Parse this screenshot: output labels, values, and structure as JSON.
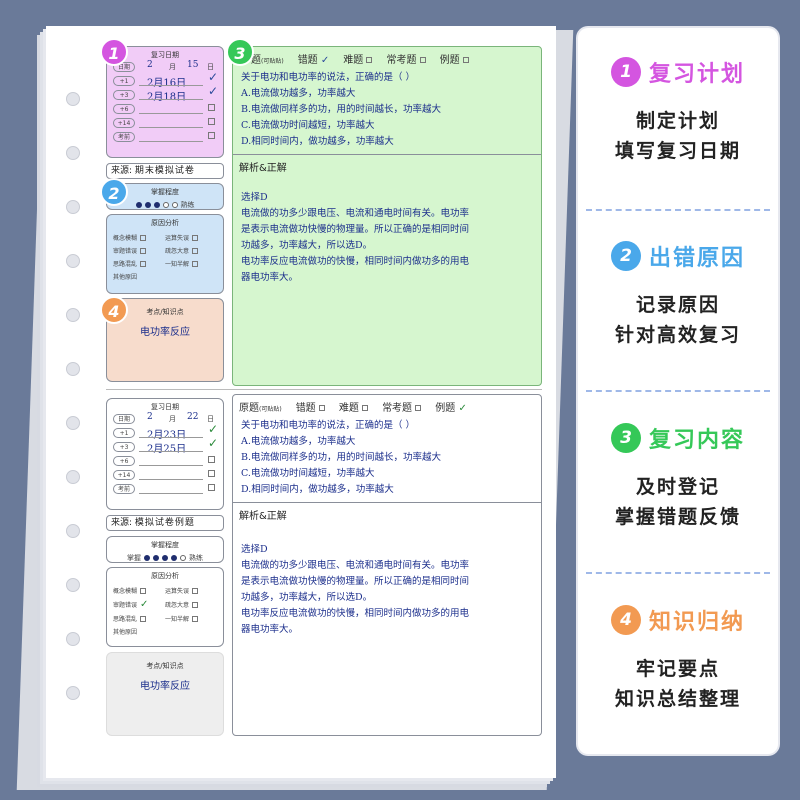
{
  "colors": {
    "purple": "#d455e0",
    "blue": "#4aa8ea",
    "green": "#35c858",
    "orange": "#f29a52",
    "purple_bg": "#f1ccf7",
    "blue_bg": "#cfe4f7",
    "green_bg": "#d6f6cf",
    "orange_bg": "#f7dccc"
  },
  "badges": [
    "1",
    "2",
    "3",
    "4"
  ],
  "card1": {
    "review_date_title": "复习日期",
    "date_label": "日期",
    "date_month": "2",
    "month_unit": "月",
    "date_day": "15",
    "day_unit": "日",
    "rows": [
      {
        "tag": "+1",
        "value": "2月16日",
        "checked": true
      },
      {
        "tag": "+3",
        "value": "2月18日",
        "checked": true
      },
      {
        "tag": "+6",
        "value": "",
        "checked": false
      },
      {
        "tag": "+14",
        "value": "",
        "checked": false
      },
      {
        "tag": "考前",
        "value": "",
        "checked": false
      }
    ],
    "source_label": "来源:",
    "source_value": "期末模拟试卷",
    "mastery_title": "掌握程度",
    "mastery_end": "熟练",
    "reason_title": "原因分析",
    "reasons": [
      "概念模糊",
      "运算失误",
      "审题错误",
      "疏忽大意",
      "思路混乱",
      "一知半解"
    ],
    "other_reason": "其他原因",
    "knowledge_title": "考点/知识点",
    "knowledge_value": "电功率反应",
    "head": {
      "q": "题",
      "q_note": "(可贴贴)",
      "wrong": "错题",
      "hard": "难题",
      "common": "常考题",
      "example": "例题"
    },
    "question": [
      "关于电功和电功率的说法，正确的是（ ）",
      "A.电流做功越多，功率越大",
      "B.电流做同样多的功，用的时间越长，功率越大",
      "C.电流做功时间越短，功率越大",
      "D.相同时间内，做功越多，功率越大"
    ],
    "analysis_title": "解析&正解",
    "analysis": [
      "选择D",
      "电流做的功多少跟电压、电流和通电时间有关。电功率",
      "是表示电流做功快慢的物理量。所以正确的是相同时间",
      "功越多，功率越大，所以选D。",
      "电功率反应电流做功的快慢，相同时间内做功多的用电",
      "器电功率大。"
    ]
  },
  "card2": {
    "review_date_title": "复习日期",
    "date_label": "日期",
    "date_month": "2",
    "month_unit": "月",
    "date_day": "22",
    "day_unit": "日",
    "rows": [
      {
        "tag": "+1",
        "value": "2月23日",
        "checked": true
      },
      {
        "tag": "+3",
        "value": "2月25日",
        "checked": true
      },
      {
        "tag": "+6",
        "value": "",
        "checked": false
      },
      {
        "tag": "+14",
        "value": "",
        "checked": false
      },
      {
        "tag": "考前",
        "value": "",
        "checked": false
      }
    ],
    "source_label": "来源:",
    "source_value": "模拟试卷例题",
    "mastery_title": "掌握程度",
    "mastery_start": "掌握",
    "mastery_end": "熟练",
    "reason_title": "原因分析",
    "reasons": [
      "概念模糊",
      "运算失误",
      "审题错误",
      "疏忽大意",
      "思路混乱",
      "一知半解"
    ],
    "other_reason": "其他原因",
    "knowledge_title": "考点/知识点",
    "knowledge_value": "电功率反应",
    "head": {
      "q": "原题",
      "q_note": "(可贴贴)",
      "wrong": "错题",
      "hard": "难题",
      "common": "常考题",
      "example": "例题"
    },
    "question": [
      "关于电功和电功率的说法，正确的是（ ）",
      "A.电流做功越多，功率越大",
      "B.电流做同样多的功，用的时间越长，功率越大",
      "C.电流做功时间越短，功率越大",
      "D.相同时间内，做功越多，功率越大"
    ],
    "analysis_title": "解析&正解",
    "analysis": [
      "选择D",
      "电流做的功多少跟电压、电流和通电时间有关。电功率",
      "是表示电流做功快慢的物理量。所以正确的是相同时间",
      "功越多，功率越大，所以选D。",
      "电功率反应电流做功的快慢，相同时间内做功多的用电",
      "器电功率大。"
    ]
  },
  "sidebar": [
    {
      "num": "1",
      "label": "复习计划",
      "desc": [
        "制定计划",
        "填写复习日期"
      ]
    },
    {
      "num": "2",
      "label": "出错原因",
      "desc": [
        "记录原因",
        "针对高效复习"
      ]
    },
    {
      "num": "3",
      "label": "复习内容",
      "desc": [
        "及时登记",
        "掌握错题反馈"
      ]
    },
    {
      "num": "4",
      "label": "知识归纳",
      "desc": [
        "牢记要点",
        "知识总结整理"
      ]
    }
  ]
}
